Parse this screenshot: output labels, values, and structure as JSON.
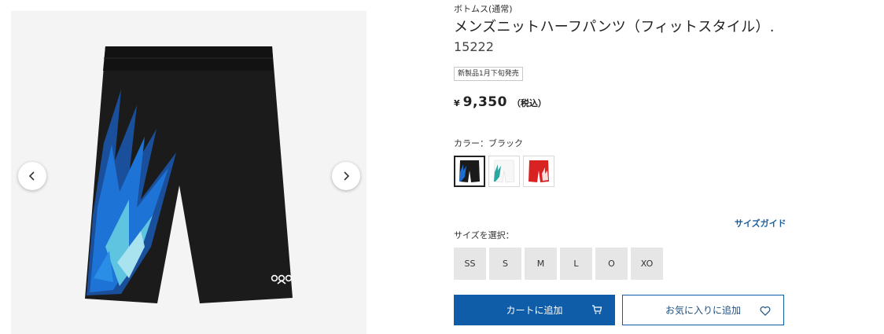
{
  "product": {
    "category": "ボトムス(通常)",
    "title": "メンズニットハーフパンツ（フィットスタイル）.",
    "code": "15222",
    "badge": "新製品1月下旬発売",
    "price": {
      "currency": "¥",
      "amount": "9,350",
      "tax_note": "（税込）"
    }
  },
  "gallery": {
    "prev_icon": "chevron-left-icon",
    "next_icon": "chevron-right-icon",
    "logo_icon": "yonex-logo-icon"
  },
  "color": {
    "label": "カラー：ブラック",
    "options": [
      {
        "name": "black",
        "hex": "#1a1a1a",
        "accent": "#1a6fd0",
        "selected": true
      },
      {
        "name": "white",
        "hex": "#f2f2f2",
        "accent": "#2aa7a0",
        "selected": false
      },
      {
        "name": "red",
        "hex": "#d92323",
        "accent": "#ffffff",
        "selected": false
      }
    ]
  },
  "size": {
    "guide_label": "サイズガイド",
    "label": "サイズを選択：",
    "options": [
      "SS",
      "S",
      "M",
      "L",
      "O",
      "XO"
    ]
  },
  "actions": {
    "cart_label": "カートに追加",
    "cart_icon": "cart-icon",
    "favorite_label": "お気に入りに追加",
    "favorite_icon": "heart-icon"
  },
  "colors": {
    "primary": "#0f5da8",
    "size_bg": "#e6e6e6",
    "link": "#1d5fa0"
  }
}
